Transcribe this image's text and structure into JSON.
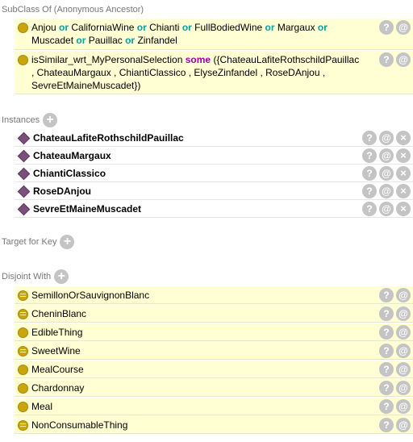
{
  "sections": {
    "subclass_of": "SubClass Of (Anonymous Ancestor)",
    "instances": "Instances",
    "target_for_key": "Target for Key",
    "disjoint_with": "Disjoint With"
  },
  "subclass": {
    "union": {
      "t1": "Anjou",
      "t2": "CaliforniaWine",
      "t3": "Chianti",
      "t4": "FullBodiedWine",
      "t5": "Margaux",
      "t6": "Muscadet",
      "t7": "Pauillac",
      "t8": "Zinfandel",
      "or": "or"
    },
    "restriction": {
      "prop": "isSimilar_wrt_MyPersonalSelection",
      "some": "some",
      "l1": "({ChateauLafiteRothschildPauillac",
      "l2": ", ChateauMargaux , ChiantiClassico , ElyseZinfandel , RoseDAnjou ,",
      "l3": "SevreEtMaineMuscadet})"
    }
  },
  "instances": [
    "ChateauLafiteRothschildPauillac",
    "ChateauMargaux",
    "ChiantiClassico",
    "RoseDAnjou",
    "SevreEtMaineMuscadet"
  ],
  "disjoint": [
    "SemillonOrSauvignonBlanc",
    "CheninBlanc",
    "EdibleThing",
    "SweetWine",
    "MealCourse",
    "Chardonnay",
    "Meal",
    "NonConsumableThing"
  ],
  "buttons": {
    "help": "?",
    "annotate": "@",
    "delete": "×",
    "add": "+"
  },
  "colors": {
    "row_bg": "#ffffd3",
    "class_icon": "#c9a50e",
    "individual_icon": "#7a4f7c",
    "keyword_or": "#00a3a3",
    "keyword_some": "#a000a0"
  },
  "icons": {
    "class": "class-circle-icon",
    "equivalent": "equivalent-class-icon",
    "individual": "individual-diamond-icon"
  }
}
